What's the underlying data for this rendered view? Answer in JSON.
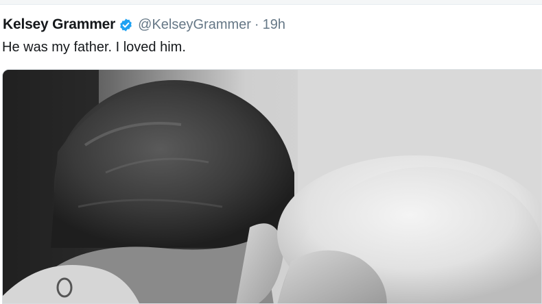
{
  "tweet": {
    "display_name": "Kelsey Grammer",
    "handle": "@KelseyGrammer",
    "separator": "·",
    "time": "19h",
    "text": "He was my father. I loved him.",
    "verified_icon": "verified-badge-icon",
    "media": {
      "type": "photo",
      "style": "black-and-white"
    }
  },
  "colors": {
    "name": "#14171a",
    "muted": "#657786",
    "verified": "#1da1f2"
  }
}
